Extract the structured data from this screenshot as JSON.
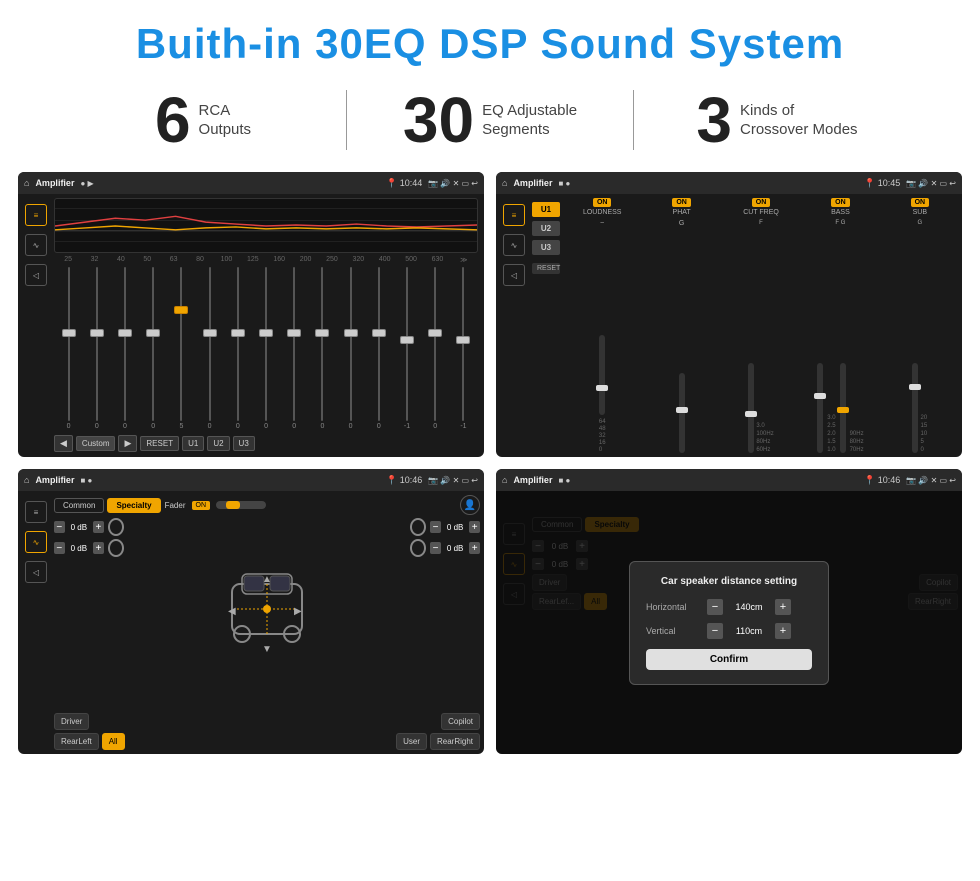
{
  "title": "Buith-in 30EQ DSP Sound System",
  "stats": [
    {
      "number": "6",
      "label": "RCA\nOutputs"
    },
    {
      "number": "30",
      "label": "EQ Adjustable\nSegments"
    },
    {
      "number": "3",
      "label": "Kinds of\nCrossover Modes"
    }
  ],
  "screens": [
    {
      "id": "eq-screen",
      "topbar": {
        "title": "Amplifier",
        "time": "10:44",
        "icons": "📷 🔊 ✕ ▭ ↩"
      },
      "type": "eq"
    },
    {
      "id": "crossover-screen",
      "topbar": {
        "title": "Amplifier",
        "time": "10:45",
        "icons": "📷 🔊 ✕ ▭ ↩"
      },
      "type": "crossover"
    },
    {
      "id": "speaker-screen",
      "topbar": {
        "title": "Amplifier",
        "time": "10:46",
        "icons": "📷 🔊 ✕ ▭ ↩"
      },
      "type": "speaker"
    },
    {
      "id": "distance-screen",
      "topbar": {
        "title": "Amplifier",
        "time": "10:46",
        "icons": "📷 🔊 ✕ ▭ ↩"
      },
      "type": "distance"
    }
  ],
  "eq": {
    "freqs": [
      "25",
      "32",
      "40",
      "50",
      "63",
      "80",
      "100",
      "125",
      "160",
      "200",
      "250",
      "320",
      "400",
      "500",
      "630"
    ],
    "values": [
      "0",
      "0",
      "0",
      "0",
      "5",
      "0",
      "0",
      "0",
      "0",
      "0",
      "0",
      "0",
      "-1",
      "0",
      "-1"
    ],
    "preset": "Custom",
    "presets": [
      "U1",
      "U2",
      "U3"
    ]
  },
  "crossover": {
    "presets": [
      "U1",
      "U2",
      "U3"
    ],
    "channels": [
      {
        "label": "LOUDNESS",
        "on": true
      },
      {
        "label": "PHAT",
        "on": true
      },
      {
        "label": "CUT FREQ",
        "on": true
      },
      {
        "label": "BASS",
        "on": true
      },
      {
        "label": "SUB",
        "on": true
      }
    ]
  },
  "speaker": {
    "tabs": [
      "Common",
      "Specialty"
    ],
    "fader": "ON",
    "positions": [
      "Driver",
      "RearLeft",
      "All",
      "RearRight",
      "Copilot",
      "User"
    ]
  },
  "distance": {
    "dialog": {
      "title": "Car speaker distance setting",
      "horizontal_label": "Horizontal",
      "horizontal_value": "140cm",
      "vertical_label": "Vertical",
      "vertical_value": "110cm",
      "confirm_label": "Confirm"
    }
  },
  "sidebar_icons": [
    "home",
    "equalizer",
    "waveform",
    "volume"
  ],
  "topbar_app": "Amplifier",
  "on_label": "ON",
  "reset_label": "RESET"
}
